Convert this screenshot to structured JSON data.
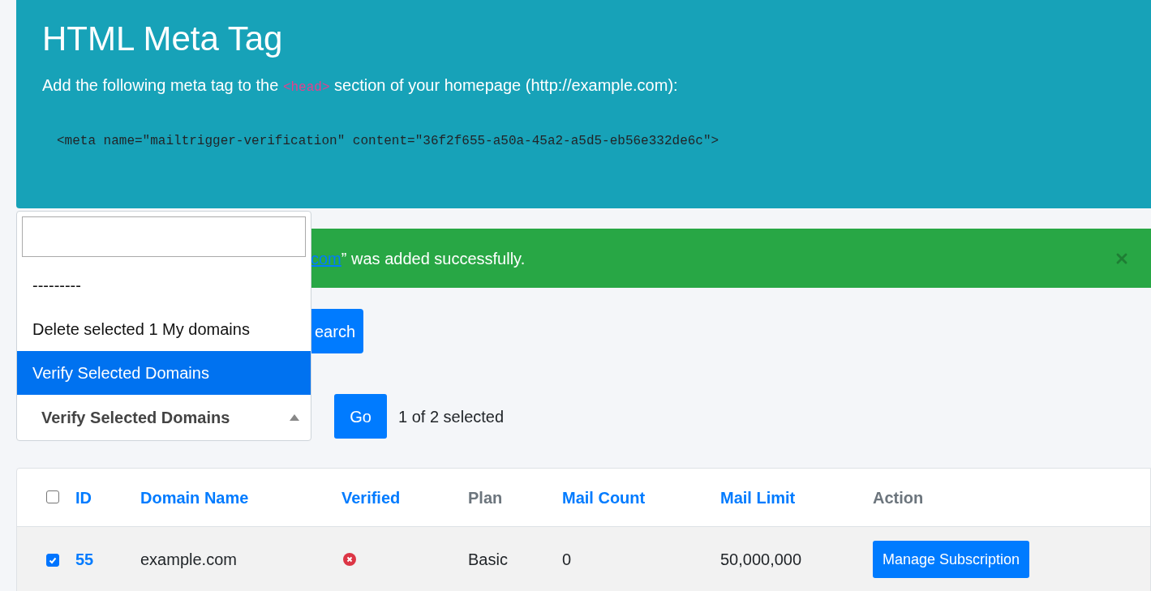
{
  "header": {
    "title": "HTML Meta Tag",
    "instruction_before": "Add the following meta tag to the",
    "code_inline": "<head>",
    "instruction_after": "section of your homepage (http://example.com):",
    "code_block": "<meta name=\"mailtrigger-verification\" content=\"36f2f655-a50a-45a2-a5d5-eb56e332de6c\">"
  },
  "alert": {
    "link": "com",
    "message": "” was added successfully."
  },
  "search_button": "earch",
  "action_select": {
    "expanded": true,
    "value": "Verify Selected Domains",
    "options": [
      {
        "label": "---------",
        "selected": false
      },
      {
        "label": "Delete selected 1 My domains",
        "selected": false
      },
      {
        "label": "Verify Selected Domains",
        "selected": true
      }
    ]
  },
  "go_button": "Go",
  "selection_count": "1 of 2 selected",
  "table": {
    "select_all_checked": false,
    "columns": [
      {
        "label": "ID",
        "sortable": true
      },
      {
        "label": "Domain Name",
        "sortable": true
      },
      {
        "label": "Verified",
        "sortable": true
      },
      {
        "label": "Plan",
        "sortable": false
      },
      {
        "label": "Mail Count",
        "sortable": true
      },
      {
        "label": "Mail Limit",
        "sortable": true
      },
      {
        "label": "Action",
        "sortable": false
      }
    ],
    "rows": [
      {
        "checked": true,
        "id": "55",
        "domain": "example.com",
        "verified": false,
        "plan": "Basic",
        "mail_count": "0",
        "mail_limit": "50,000,000",
        "action": "Manage Subscription"
      }
    ]
  }
}
